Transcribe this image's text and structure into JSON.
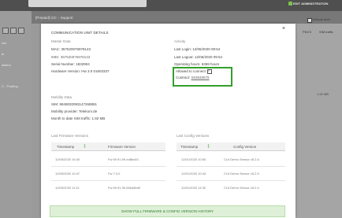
{
  "background": {
    "search_icon": "search-icon",
    "admin_label": "EDIT ADMINISTRATION",
    "tab_title": "[Prepaid] CiC – Support",
    "include_archive_label": "Include arch",
    "side_items": [
      "ces",
      "dr",
      "alation",
      "C - Floating"
    ],
    "columns": [
      "ders",
      "PDCS",
      "SIM traffic"
    ],
    "cells": [
      "1.92 MB"
    ]
  },
  "modal": {
    "title": "COMMUNICATION UNIT DETAILS",
    "close_icon": "close-icon",
    "master_data": {
      "heading": "Master Data",
      "mac": "MAC: 357520076978143",
      "imei": "IMEI: 357520076978143",
      "serial": "Serial Number: 1832904",
      "hardware": "Hardware Version: Hw 3.0 01603337"
    },
    "activity": {
      "heading": "Activity",
      "last_login": "Last Login: 12/06/2020 09:54",
      "last_logout": "Last Logout: 12/06/2020 09:54",
      "operating_hours": "Operating hours: 6369 hours",
      "allowed_label": "Allowed to connect:",
      "contract_label": "Contract:",
      "contract_value": "S63848679"
    },
    "mobility": {
      "heading": "Mobility Data",
      "sim": "SIM: 8949020093147269851",
      "provider": "Mobility provider: Telekom.de",
      "traffic": "Month to date SIM traffic: 1.92 MB"
    },
    "firmware": {
      "heading": "Last Firmware Versions",
      "col_timestamp": "Timestamp",
      "col_version": "Firmware Version",
      "rows": [
        {
          "ts": "12/05/2020 16:40",
          "ver": "Fw 69.91.99-ed8bd01"
        },
        {
          "ts": "12/05/2020 10:47",
          "ver": "Fw 7.3.0"
        },
        {
          "ts": "12/05/2020 11:41",
          "ver": "Fw 69.91.99-60ed8bd0"
        }
      ]
    },
    "config": {
      "heading": "Last Config Versions",
      "col_timestamp": "Timestamp",
      "col_version": "Config Version",
      "rows": [
        {
          "ts": "12/01/2020 10:50",
          "ver": "CLit Demo Sensor v5.2.6"
        },
        {
          "ts": "12/01/2020 10:43",
          "ver": "CLit Demo Sensor v5.2.5"
        },
        {
          "ts": "12/01/2020 14:32",
          "ver": "CLit Demo Sensor v5.2.4"
        }
      ]
    },
    "history_button": "SHOW FULL FIRMWARE & CONFIG VERSION HISTORY"
  }
}
